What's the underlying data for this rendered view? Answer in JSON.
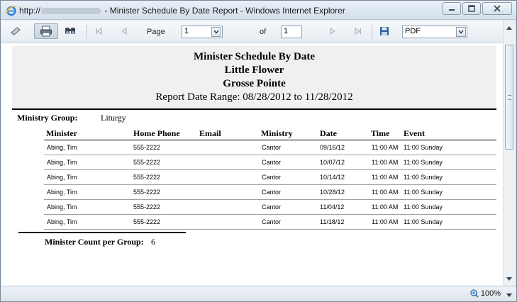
{
  "window": {
    "title_prefix": "http://",
    "title_suffix": "- Minister Schedule By Date Report - Windows Internet Explorer"
  },
  "toolbar": {
    "page_label": "Page",
    "page_value": "1",
    "of_label": "of",
    "total_pages": "1",
    "export_format": "PDF"
  },
  "report": {
    "title": "Minister Schedule By Date",
    "parish": "Little Flower",
    "location": "Grosse Pointe",
    "date_range": "Report Date Range: 08/28/2012 to 11/28/2012",
    "group_label": "Ministry Group:",
    "group_value": "Liturgy",
    "columns": {
      "minister": "Minister",
      "home_phone": "Home Phone",
      "email": "Email",
      "ministry": "Ministry",
      "date": "Date",
      "time": "Time",
      "event": "Event"
    },
    "rows": [
      {
        "minister": "Abing, Tim",
        "home_phone": "555-2222",
        "email": "",
        "ministry": "Cantor",
        "date": "09/16/12",
        "time": "11:00 AM",
        "event": "11:00 Sunday"
      },
      {
        "minister": "Abing, Tim",
        "home_phone": "555-2222",
        "email": "",
        "ministry": "Cantor",
        "date": "10/07/12",
        "time": "11:00 AM",
        "event": "11:00 Sunday"
      },
      {
        "minister": "Abing, Tim",
        "home_phone": "555-2222",
        "email": "",
        "ministry": "Cantor",
        "date": "10/14/12",
        "time": "11:00 AM",
        "event": "11:00 Sunday"
      },
      {
        "minister": "Abing, Tim",
        "home_phone": "555-2222",
        "email": "",
        "ministry": "Cantor",
        "date": "10/28/12",
        "time": "11:00 AM",
        "event": "11:00 Sunday"
      },
      {
        "minister": "Abing, Tim",
        "home_phone": "555-2222",
        "email": "",
        "ministry": "Cantor",
        "date": "11/04/12",
        "time": "11:00 AM",
        "event": "11:00 Sunday"
      },
      {
        "minister": "Abing, Tim",
        "home_phone": "555-2222",
        "email": "",
        "ministry": "Cantor",
        "date": "11/18/12",
        "time": "11:00 AM",
        "event": "11:00 Sunday"
      }
    ],
    "count_label": "Minister Count per Group:",
    "count_value": "6"
  },
  "status": {
    "zoom": "100%"
  },
  "icons": {
    "ie": "internet-explorer-icon",
    "minimize": "minimize-icon",
    "maximize": "maximize-icon",
    "close": "close-icon",
    "print": "print-icon",
    "find": "find-icon",
    "first": "first-page-icon",
    "prev": "previous-page-icon",
    "next": "next-page-icon",
    "last": "last-page-icon",
    "save": "save-icon",
    "zoom": "zoom-icon"
  },
  "colors": {
    "titlebar": "#d4e0ec",
    "toolbar": "#e6ecf2",
    "report_header_bg": "#f0f0f0"
  }
}
